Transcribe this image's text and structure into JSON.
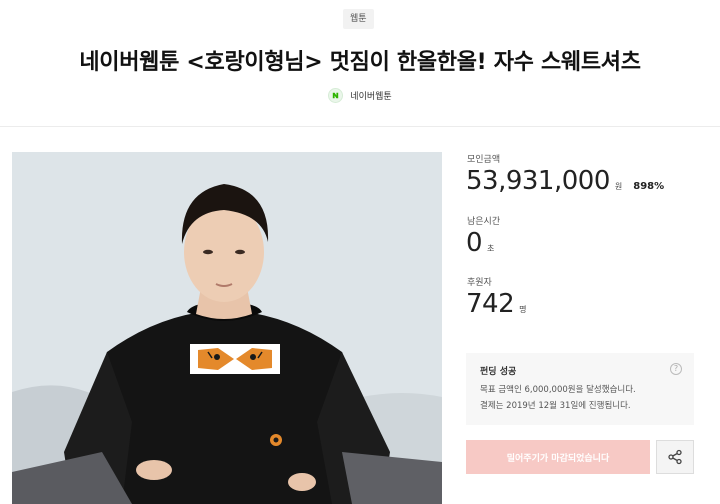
{
  "category": {
    "label": "웹툰"
  },
  "title": "네이버웹툰 <호랑이형님> 멋짐이 한올한올! 자수 스웨트셔츠",
  "creator": {
    "name": "네이버웹툰",
    "icon": "naver-webtoon-logo-icon"
  },
  "stats": {
    "raised": {
      "label": "모인금액",
      "value": "53,931,000",
      "unit": "원",
      "percent": "898%"
    },
    "time_left": {
      "label": "남은시간",
      "value": "0",
      "unit": "초"
    },
    "backers": {
      "label": "후원자",
      "value": "742",
      "unit": "명"
    }
  },
  "funding_status": {
    "title": "펀딩 성공",
    "line1": "목표 금액인 6,000,000원을 달성했습니다.",
    "line2": "결제는 2019년 12월 31일에 진행됩니다.",
    "help_icon": "question-circle-icon"
  },
  "actions": {
    "cta_label": "밀어주기가 마감되었습니다",
    "share_icon": "share-icon"
  },
  "colors": {
    "cta_background": "#f7c9c5",
    "creator_logo_green": "#2db400"
  }
}
